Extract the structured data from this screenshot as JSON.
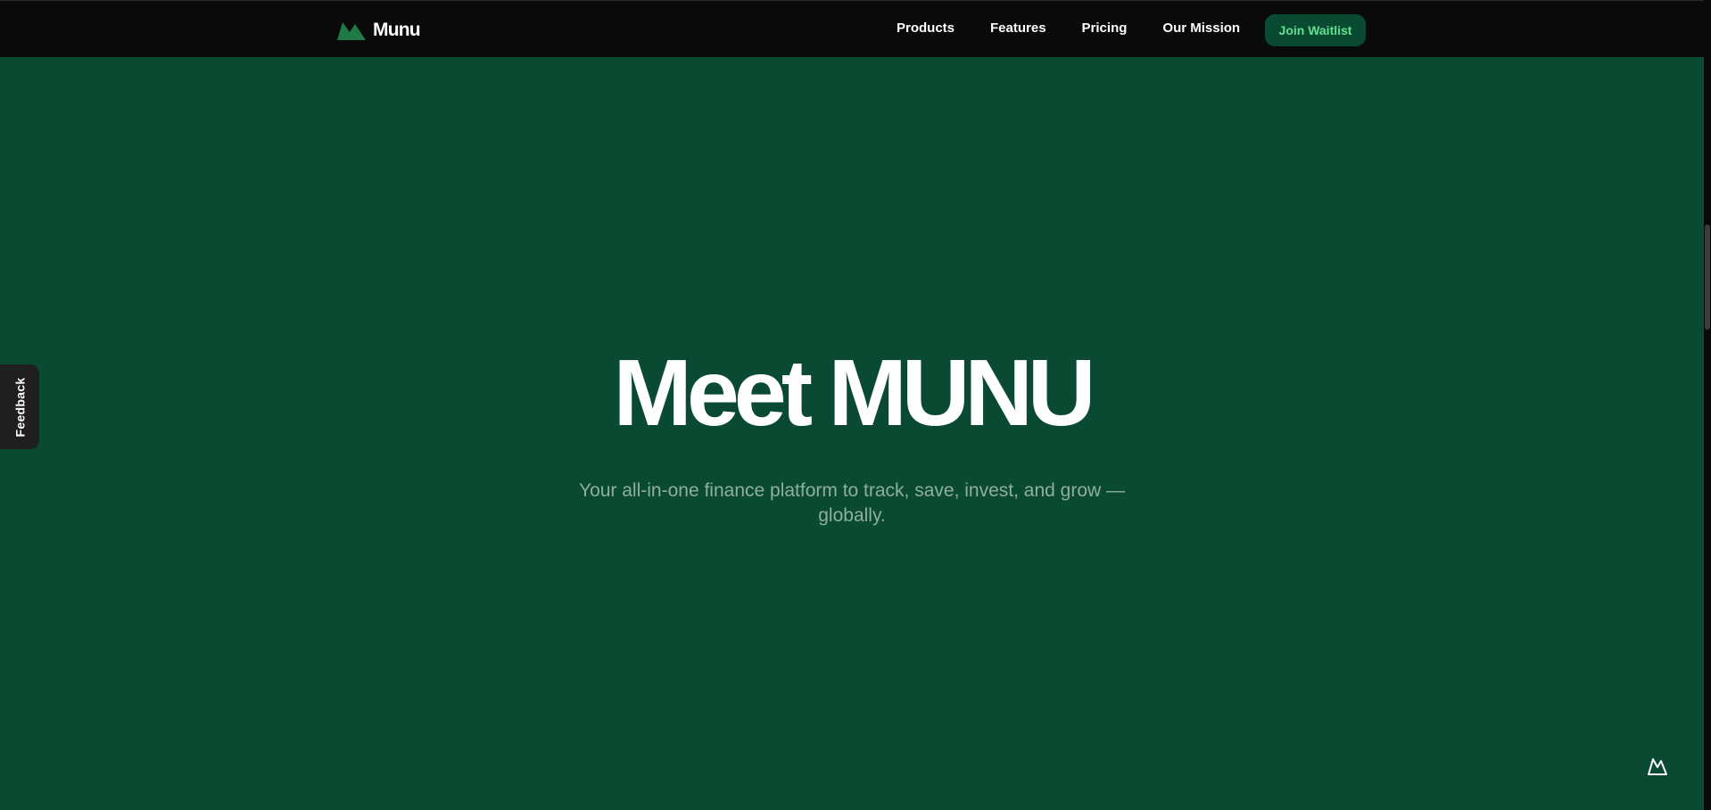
{
  "colors": {
    "hero_background": "#0b4a32",
    "navbar_background": "#0a0a0a",
    "accent_green": "#63e08f",
    "brand_mark_green": "#1f7a45",
    "subtitle_text": "#8fae9f"
  },
  "navbar": {
    "brand_icon": "mountain-logo-icon",
    "brand_name": "Munu",
    "links": [
      {
        "label": "Products"
      },
      {
        "label": "Features"
      },
      {
        "label": "Pricing"
      },
      {
        "label": "Our Mission"
      }
    ],
    "cta_label": "Join Waitlist"
  },
  "hero": {
    "title": "Meet MUNU",
    "subtitle": "Your all-in-one finance platform to track, save, invest, and grow — globally."
  },
  "feedback_tab": {
    "label": "Feedback"
  },
  "floating_icon": "mountain-icon"
}
